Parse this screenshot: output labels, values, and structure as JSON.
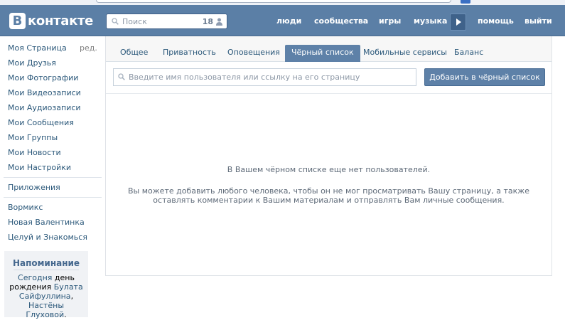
{
  "header": {
    "logo_badge": "В",
    "logo_text": "контакте",
    "search": {
      "placeholder": "Поиск",
      "count": "18"
    },
    "nav": {
      "people": "люди",
      "communities": "сообщества",
      "games": "игры",
      "music": "музыка",
      "help": "помощь",
      "exit": "выйти"
    },
    "icons": {
      "search": "magnifier-icon",
      "user": "person-icon",
      "play": "play-icon"
    }
  },
  "sidebar": {
    "items": [
      "Моя Страница",
      "Мои Друзья",
      "Мои Фотографии",
      "Мои Видеозаписи",
      "Мои Аудиозаписи",
      "Мои Сообщения",
      "Мои Группы",
      "Мои Новости",
      "Мои Настройки"
    ],
    "edit_label": "ред.",
    "apps_label": "Приложения",
    "app_items": [
      "Вормикс",
      "Новая Валентинка",
      "Целуй и Знакомься"
    ]
  },
  "reminder": {
    "title": "Напоминание",
    "today": "Сегодня",
    "birthday": "день рождения",
    "person1": "Булата Сайфуллина",
    "comma": ",",
    "person2": "Настёны Глуховой",
    "dot": "."
  },
  "tabs": [
    {
      "label": "Общее",
      "active": false
    },
    {
      "label": "Приватность",
      "active": false
    },
    {
      "label": "Оповещения",
      "active": false
    },
    {
      "label": "Чёрный список",
      "active": true
    },
    {
      "label": "Мобильные сервисы",
      "active": false
    },
    {
      "label": "Баланс",
      "active": false
    }
  ],
  "blacklist": {
    "input_placeholder": "Введите имя пользователя или ссылку на его страницу",
    "add_button": "Добавить в чёрный список",
    "empty_title": "В Вашем чёрном списке еще нет пользователей.",
    "empty_line1": "Вы можете добавить любого человека, чтобы он не мог просматривать Вашу страницу, а также",
    "empty_line2": "оставлять комментарии к Вашим материалам и отправлять Вам личные сообщения."
  },
  "colors": {
    "header_bg": "#5b7fa6",
    "link": "#2b587a",
    "active_tab": "#5e81a8",
    "muted_text": "#5e6a78"
  }
}
